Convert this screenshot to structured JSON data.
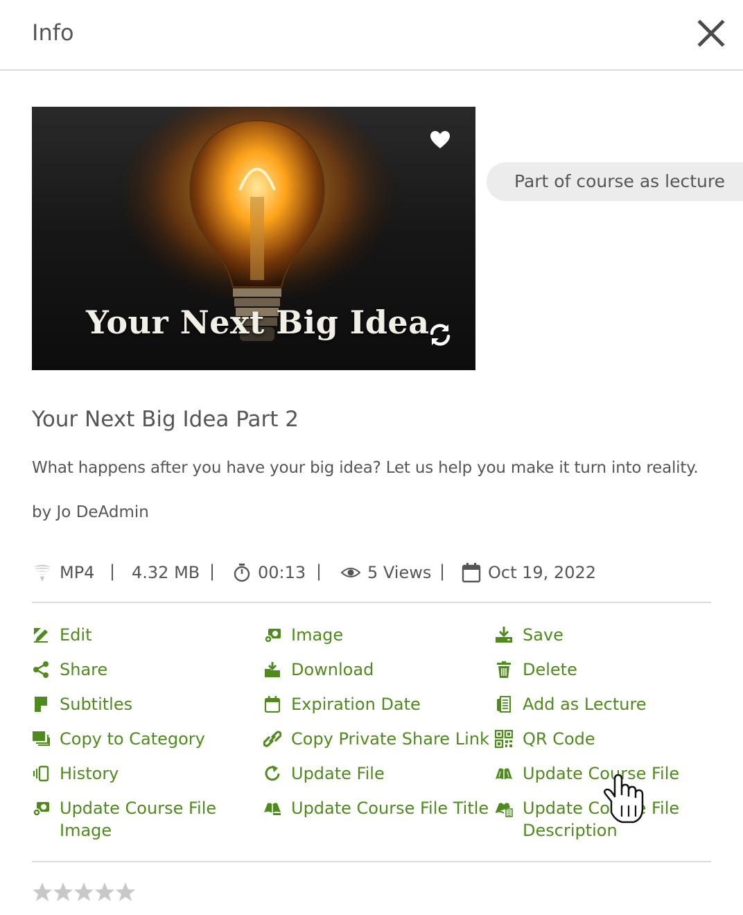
{
  "header": {
    "title": "Info",
    "close_icon": "close-icon"
  },
  "thumbnail": {
    "caption": "Your Next Big Idea",
    "favorite_icon": "heart-icon",
    "refresh_icon": "refresh-icon"
  },
  "course_badge": "Part of course as lecture",
  "video": {
    "title": "Your Next Big Idea Part 2",
    "description": "What happens after you have your big idea? Let us help you make it turn into reality.",
    "author": "by Jo DeAdmin"
  },
  "meta": {
    "format": "MP4",
    "size": "4.32 MB",
    "duration": "00:13",
    "views": "5 Views",
    "date": "Oct 19, 2022",
    "separator": "|"
  },
  "actions": {
    "edit": "Edit",
    "share": "Share",
    "subtitles": "Subtitles",
    "copy_to_category": "Copy to Category",
    "history": "History",
    "update_course_file_image": "Update Course File Image",
    "image": "Image",
    "download": "Download",
    "expiration_date": "Expiration Date",
    "copy_private_share_link": "Copy Private Share Link",
    "update_file": "Update File",
    "update_course_file_title": "Update Course File Title",
    "save": "Save",
    "delete": "Delete",
    "add_as_lecture": "Add as Lecture",
    "qr_code": "QR Code",
    "update_course_file": "Update Course File",
    "update_course_file_description": "Update Course File Description"
  },
  "rating": {
    "value": 0,
    "max": 5
  },
  "colors": {
    "accent": "#4e8a1c",
    "text": "#555555",
    "divider": "#dcdcdc",
    "badge_bg": "#ececec"
  }
}
